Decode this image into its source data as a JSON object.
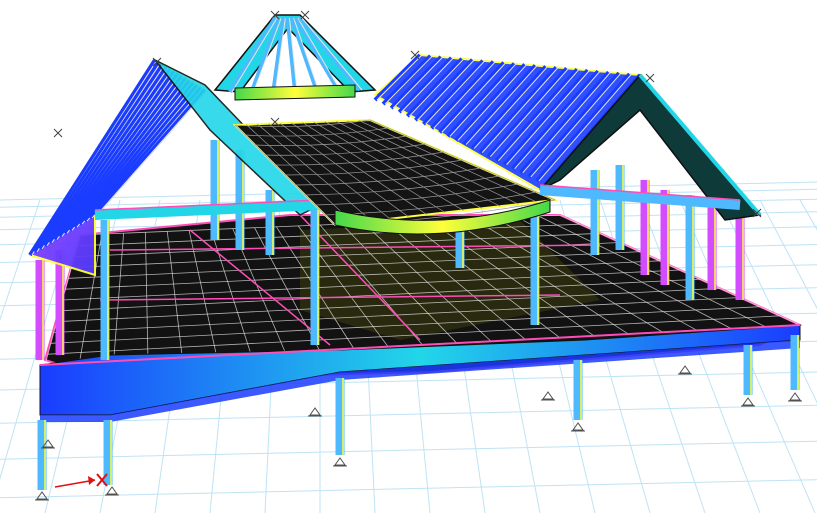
{
  "viewport": {
    "background": "#ffffff",
    "grid_color": "#bfe3f5",
    "frame_colors": {
      "beam_blue": "#1a3cff",
      "beam_cyan": "#22d6e8",
      "beam_light": "#4fb9ff",
      "outline_yellow": "#ffff3a",
      "column_magenta": "#d44cff",
      "slab_dark": "#101010",
      "mesh_white": "#e8e8e8",
      "stress_red": "#ff3b2f",
      "stress_green": "#44d84a",
      "stress_orange": "#ffb020",
      "axis_red": "#e01010"
    },
    "icons": {
      "support": "pin-support-icon",
      "origin": "origin-axis-icon",
      "node": "node-cross-icon"
    }
  }
}
